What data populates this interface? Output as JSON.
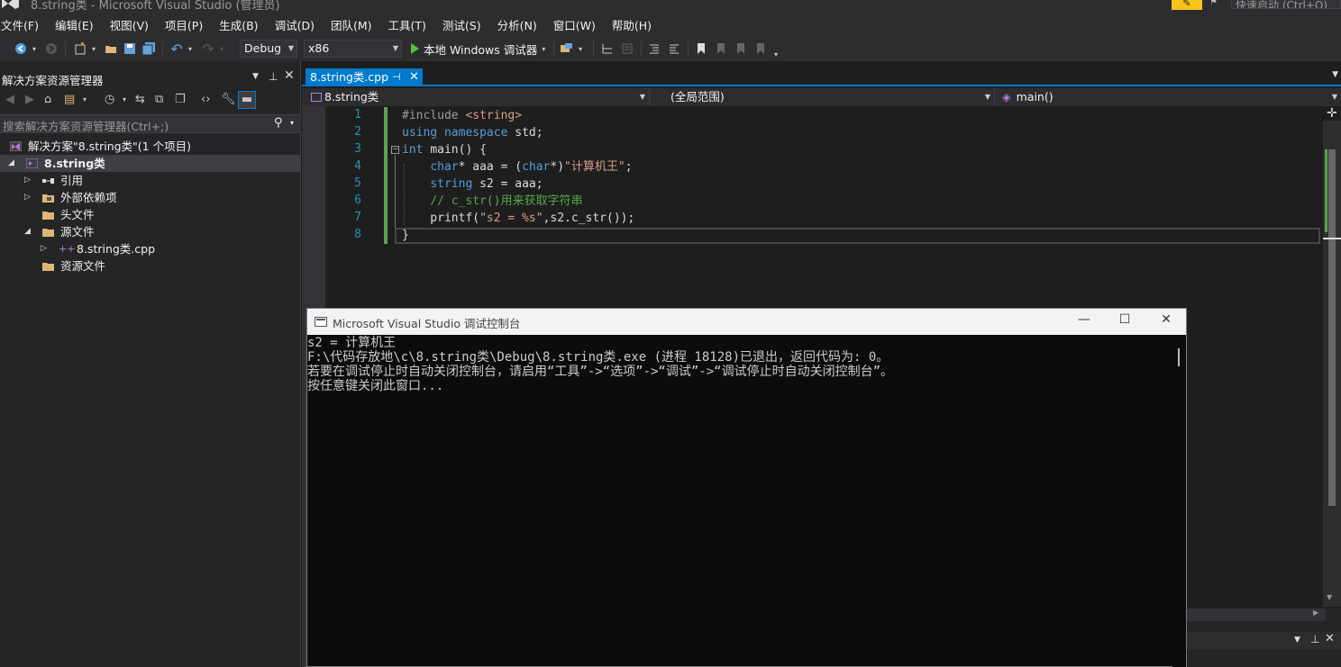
{
  "window": {
    "title": "8.string类 - Microsoft Visual Studio (管理员)",
    "quick_launch_placeholder": "快速启动 (Ctrl+Q)",
    "feedback_icon": "feedback-icon"
  },
  "menu": [
    "文件(F)",
    "编辑(E)",
    "视图(V)",
    "项目(P)",
    "生成(B)",
    "调试(D)",
    "团队(M)",
    "工具(T)",
    "测试(S)",
    "分析(N)",
    "窗口(W)",
    "帮助(H)"
  ],
  "toolbar": {
    "configuration": "Debug",
    "platform": "x86",
    "run_label": "本地 Windows 调试器",
    "run_icon_color": "#55c33b"
  },
  "solution_explorer": {
    "title": "解决方案资源管理器",
    "search_placeholder": "搜索解决方案资源管理器(Ctrl+;)",
    "tree": [
      {
        "label": "解决方案\"8.string类\"(1 个项目)",
        "icon": "solution-icon"
      },
      {
        "label": "8.string类",
        "icon": "cpp-project-icon",
        "selected": true,
        "bold": true
      },
      {
        "label": "引用",
        "icon": "references-icon"
      },
      {
        "label": "外部依赖项",
        "icon": "external-deps-icon"
      },
      {
        "label": "头文件",
        "icon": "folder-icon"
      },
      {
        "label": "源文件",
        "icon": "folder-icon"
      },
      {
        "label": "8.string类.cpp",
        "icon": "cpp-file-icon"
      },
      {
        "label": "资源文件",
        "icon": "folder-icon"
      }
    ]
  },
  "editor": {
    "tab_label": "8.string类.cpp",
    "nav": {
      "project": "8.string类",
      "scope": "(全局范围)",
      "member": "main()"
    },
    "line_numbers": [
      "1",
      "2",
      "3",
      "4",
      "5",
      "6",
      "7",
      "8"
    ],
    "lines": [
      [
        {
          "t": "#include ",
          "c": "pre"
        },
        {
          "t": "<string>",
          "c": "str"
        }
      ],
      [
        {
          "t": "using ",
          "c": "kw"
        },
        {
          "t": "namespace ",
          "c": "kw"
        },
        {
          "t": "std;",
          "c": ""
        }
      ],
      [
        {
          "t": "int ",
          "c": "kw"
        },
        {
          "t": "main() {",
          "c": ""
        }
      ],
      [
        {
          "t": "    ",
          "c": ""
        },
        {
          "t": "char",
          "c": "kw"
        },
        {
          "t": "* aaa = (",
          "c": ""
        },
        {
          "t": "char",
          "c": "kw"
        },
        {
          "t": "*)",
          "c": ""
        },
        {
          "t": "\"计算机王\"",
          "c": "str"
        },
        {
          "t": ";",
          "c": ""
        }
      ],
      [
        {
          "t": "    ",
          "c": ""
        },
        {
          "t": "string",
          "c": "kw"
        },
        {
          "t": " s2 = aaa;",
          "c": ""
        }
      ],
      [
        {
          "t": "    ",
          "c": ""
        },
        {
          "t": "// c_str()用来获取字符串",
          "c": "com"
        }
      ],
      [
        {
          "t": "    printf(",
          "c": ""
        },
        {
          "t": "\"s2 = %s\"",
          "c": "str"
        },
        {
          "t": ",s2.c_str());",
          "c": ""
        }
      ],
      [
        {
          "t": "}",
          "c": ""
        }
      ]
    ]
  },
  "console": {
    "title": "Microsoft Visual Studio 调试控制台",
    "lines": [
      "s2 = 计算机王",
      "F:\\代码存放地\\c\\8.string类\\Debug\\8.string类.exe (进程 18128)已退出，返回代码为: 0。",
      "若要在调试停止时自动关闭控制台，请启用“工具”->“选项”->“调试”->“调试停止时自动关闭控制台”。",
      "按任意键关闭此窗口..."
    ]
  },
  "colors": {
    "accent": "#007acc",
    "keyword": "#569cd6",
    "string": "#d69d85",
    "comment": "#57a64a",
    "line_number": "#2b91af"
  }
}
